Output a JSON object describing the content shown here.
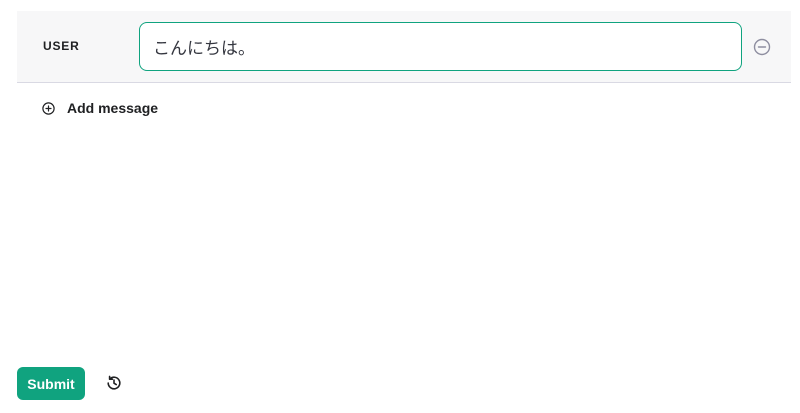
{
  "messages": [
    {
      "role_label": "USER",
      "content": "こんにちは。",
      "remove_icon": "minus-circle-icon"
    }
  ],
  "add_message": {
    "label": "Add message",
    "icon": "plus-circle-icon"
  },
  "footer": {
    "submit_label": "Submit",
    "history_icon": "history-icon"
  },
  "colors": {
    "accent": "#10a37f",
    "row_background": "#f7f7f8"
  }
}
